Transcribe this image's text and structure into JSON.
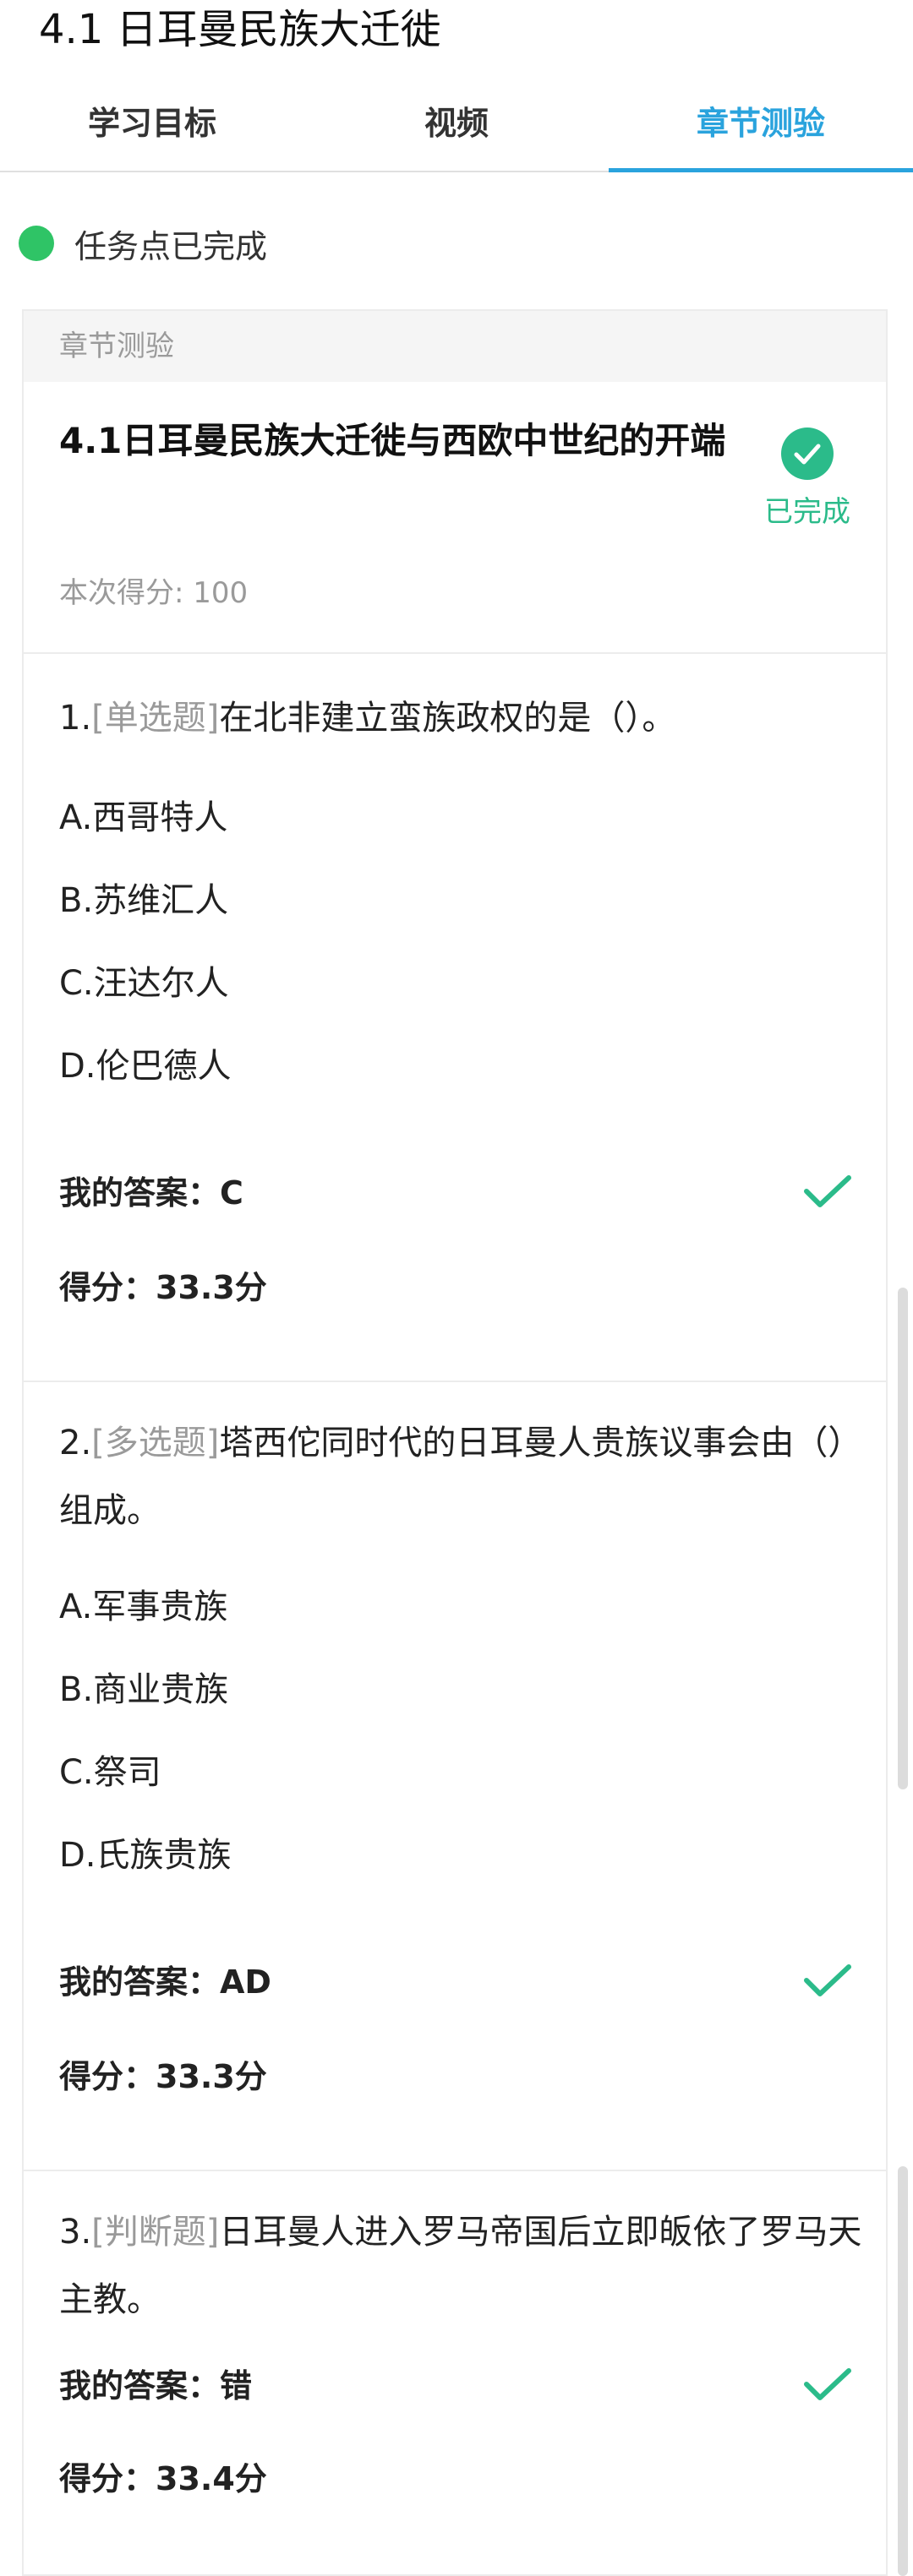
{
  "header": {
    "title": "4.1 日耳曼民族大迁徙",
    "tabs": [
      {
        "label": "学习目标",
        "active": false
      },
      {
        "label": "视频",
        "active": false
      },
      {
        "label": "章节测验",
        "active": true
      }
    ]
  },
  "status": {
    "text": "任务点已完成",
    "dot_color": "#2fc466"
  },
  "card": {
    "section_label": "章节测验",
    "quiz_title": "4.1日耳曼民族大迁徙与西欧中世纪的开端",
    "completed_label": "已完成",
    "score_text": "本次得分: 100"
  },
  "questions": [
    {
      "number": "1.",
      "type": "[单选题]",
      "text": "在北非建立蛮族政权的是（）。",
      "options": [
        "A.西哥特人",
        "B.苏维汇人",
        "C.汪达尔人",
        "D.伦巴德人"
      ],
      "answer": "我的答案：C",
      "score": "得分：33.3分",
      "correct": true
    },
    {
      "number": "2.",
      "type": "[多选题]",
      "text": "塔西佗同时代的日耳曼人贵族议事会由（）组成。",
      "options": [
        "A.军事贵族",
        "B.商业贵族",
        "C.祭司",
        "D.氏族贵族"
      ],
      "answer": "我的答案：AD",
      "score": "得分：33.3分",
      "correct": true
    },
    {
      "number": "3.",
      "type": "[判断题]",
      "text": "日耳曼人进入罗马帝国后立即皈依了罗马天主教。",
      "options": [],
      "answer": "我的答案：错",
      "score": "得分：33.4分",
      "correct": true
    }
  ],
  "colors": {
    "accent": "#2aa3dd",
    "success": "#2bbb8a",
    "muted": "#9a9a9a"
  }
}
